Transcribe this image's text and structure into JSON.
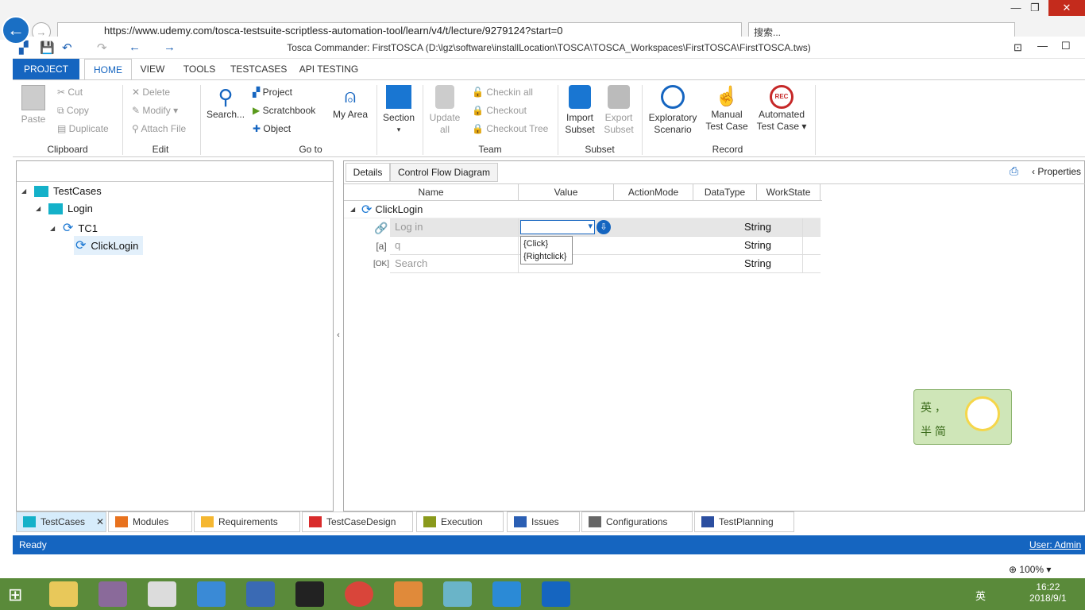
{
  "browser": {
    "url": "https://www.udemy.com/tosca-testsuite-scriptless-automation-tool/learn/v4/t/lecture/9279124?start=0",
    "search_placeholder": "搜索...",
    "zoom": "100%"
  },
  "window": {
    "title": "Tosca Commander: FirstTOSCA (D:\\lgz\\software\\installLocation\\TOSCA\\TOSCA_Workspaces\\FirstTOSCA\\FirstTOSCA.tws)"
  },
  "ribbon_tabs": [
    "PROJECT",
    "HOME",
    "VIEW",
    "TOOLS",
    "TESTCASES",
    "API TESTING"
  ],
  "ribbon": {
    "clipboard": {
      "label": "Clipboard",
      "paste": "Paste",
      "cut": "Cut",
      "copy": "Copy",
      "duplicate": "Duplicate"
    },
    "edit": {
      "label": "Edit",
      "delete": "Delete",
      "modify": "Modify",
      "attach": "Attach File"
    },
    "goto": {
      "label": "Go to",
      "search": "Search...",
      "project": "Project",
      "scratchbook": "Scratchbook",
      "object": "Object",
      "myarea": "My Area"
    },
    "section": {
      "label": "Section"
    },
    "team": {
      "label": "Team",
      "update1": "Update",
      "update2": "all",
      "checkin": "Checkin all",
      "checkout": "Checkout",
      "checkout_tree": "Checkout Tree"
    },
    "subset": {
      "label": "Subset",
      "import1": "Import",
      "import2": "Subset",
      "export1": "Export",
      "export2": "Subset"
    },
    "record": {
      "label": "Record",
      "expl1": "Exploratory",
      "expl2": "Scenario",
      "manual1": "Manual",
      "manual2": "Test Case",
      "auto1": "Automated",
      "auto2": "Test Case",
      "rec": "REC"
    }
  },
  "tree": {
    "root": "TestCases",
    "folder": "Login",
    "testcase": "TC1",
    "step": "ClickLogin"
  },
  "detail_tabs": {
    "details": "Details",
    "flow": "Control Flow Diagram",
    "properties": "Properties"
  },
  "grid": {
    "columns": [
      "Name",
      "Value",
      "ActionMode",
      "DataType",
      "WorkState"
    ],
    "parent": "ClickLogin",
    "rows": [
      {
        "name": "Log in",
        "value": "",
        "datatype": "String"
      },
      {
        "name": "q",
        "value": "",
        "datatype": "String"
      },
      {
        "name": "Search",
        "value": "",
        "datatype": "String"
      }
    ],
    "dropdown_options": [
      "{Click}",
      "{Rightclick}"
    ]
  },
  "bottom_tabs": [
    {
      "label": "TestCases",
      "color": "#14b1c9"
    },
    {
      "label": "Modules",
      "color": "#e8721e"
    },
    {
      "label": "Requirements",
      "color": "#f5b731"
    },
    {
      "label": "TestCaseDesign",
      "color": "#d92b2b"
    },
    {
      "label": "Execution",
      "color": "#8a9a1c"
    },
    {
      "label": "Issues",
      "color": "#2b5fb4"
    },
    {
      "label": "Configurations",
      "color": "#666666"
    },
    {
      "label": "TestPlanning",
      "color": "#2b4ea0"
    }
  ],
  "status": {
    "left": "Ready",
    "right": "User: Admin"
  },
  "ime": {
    "line1": "英 ，",
    "line2": "半 简"
  },
  "taskbar": {
    "time": "16:22",
    "date": "2018/9/1",
    "lang": "英"
  }
}
